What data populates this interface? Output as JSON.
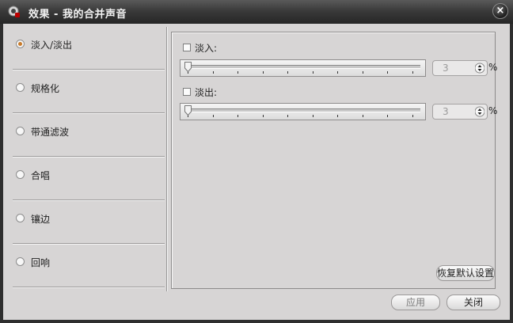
{
  "window": {
    "title": "效果 - 我的合并声音"
  },
  "sidebar": {
    "items": [
      {
        "label": "淡入/淡出",
        "selected": true
      },
      {
        "label": "规格化",
        "selected": false
      },
      {
        "label": "带通滤波",
        "selected": false
      },
      {
        "label": "合唱",
        "selected": false
      },
      {
        "label": "镶边",
        "selected": false
      },
      {
        "label": "回响",
        "selected": false
      }
    ]
  },
  "fade_in": {
    "label": "淡入:",
    "checked": false,
    "value": "3",
    "unit": "%"
  },
  "fade_out": {
    "label": "淡出:",
    "checked": false,
    "value": "3",
    "unit": "%"
  },
  "buttons": {
    "restore": "恢复默认设置",
    "apply": "应用",
    "close": "关闭"
  },
  "colors": {
    "titlebar": "#3a3a3a",
    "body": "#d7d5d5",
    "radio_selected": "#c77a2b"
  },
  "icons": {
    "app": "speaker-icon",
    "close": "close-icon"
  }
}
